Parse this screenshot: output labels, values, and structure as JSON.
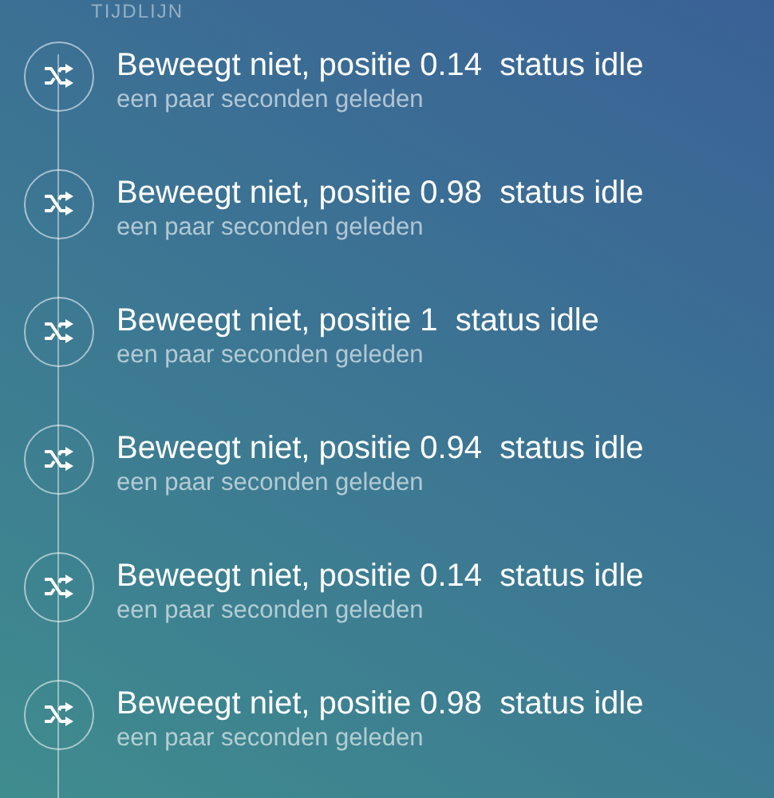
{
  "section_title": "TIJDLIJN",
  "events": [
    {
      "title": "Beweegt niet, positie 0.14  status idle",
      "time": "een paar seconden geleden"
    },
    {
      "title": "Beweegt niet, positie 0.98  status idle",
      "time": "een paar seconden geleden"
    },
    {
      "title": "Beweegt niet, positie 1  status idle",
      "time": "een paar seconden geleden"
    },
    {
      "title": "Beweegt niet, positie 0.94  status idle",
      "time": "een paar seconden geleden"
    },
    {
      "title": "Beweegt niet, positie 0.14  status idle",
      "time": "een paar seconden geleden"
    },
    {
      "title": "Beweegt niet, positie 0.98  status idle",
      "time": "een paar seconden geleden"
    }
  ]
}
